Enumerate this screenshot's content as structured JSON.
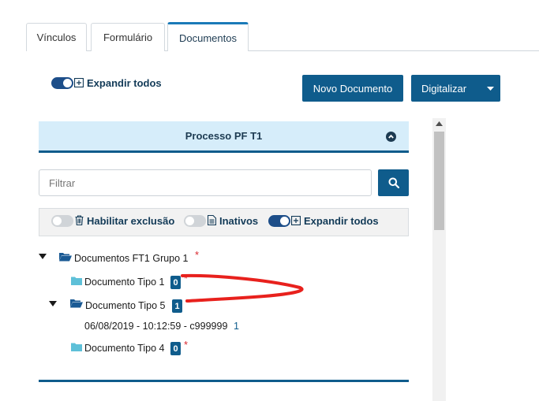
{
  "tabs": [
    {
      "label": "Vínculos"
    },
    {
      "label": "Formulário"
    },
    {
      "label": "Documentos"
    }
  ],
  "top_toggle": {
    "label": "Expandir todos",
    "on": true
  },
  "buttons": {
    "novo": "Novo Documento",
    "digitalizar": "Digitalizar"
  },
  "panel": {
    "title": "Processo PF T1"
  },
  "filter": {
    "placeholder": "Filtrar"
  },
  "options": {
    "habilitar": "Habilitar exclusão",
    "inativos": "Inativos",
    "expandir": "Expandir todos"
  },
  "tree": {
    "group": {
      "label": "Documentos FT1 Grupo 1",
      "required_mark": "*"
    },
    "items": [
      {
        "label": "Documento Tipo 1",
        "count": "0",
        "required_mark": "*"
      },
      {
        "label": "Documento Tipo 5",
        "count": "1"
      },
      {
        "label": "Documento Tipo 4",
        "count": "0",
        "required_mark": "*"
      }
    ],
    "file": {
      "label": "06/08/2019 - 10:12:59 - c999999",
      "count": "1"
    }
  },
  "colors": {
    "primary": "#0f5c8c",
    "header_bg": "#d6edfa",
    "toggle_on": "#1d4e89",
    "required": "#d9272e",
    "annotation": "#e8211d"
  }
}
